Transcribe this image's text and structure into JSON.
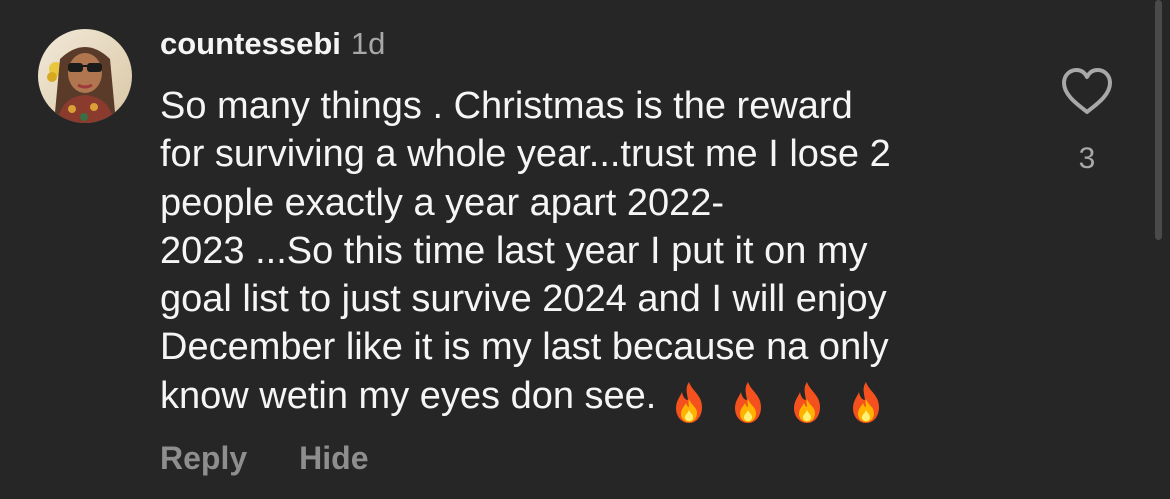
{
  "comment": {
    "username": "countessebi",
    "time": "1d",
    "text_lines": [
      "So many things . Christmas is the reward",
      "for surviving a whole year...trust me I lose 2",
      "people exactly a year apart 2022-",
      "2023 ...So this time last year I put it on my",
      "goal list to just survive 2024 and I will enjoy",
      "December like it is my last because na only",
      "know wetin my eyes don see."
    ],
    "emoji_icons": [
      "fire-emoji",
      "fire-emoji",
      "fire-emoji",
      "fire-emoji"
    ],
    "like_count": "3",
    "reply_label": "Reply",
    "hide_label": "Hide",
    "like_icon": "heart-outline-icon"
  },
  "colors": {
    "background": "#262626",
    "primary_text": "#f5f5f5",
    "secondary_text": "#a8a8a8",
    "action_text": "#8e8e8e"
  }
}
